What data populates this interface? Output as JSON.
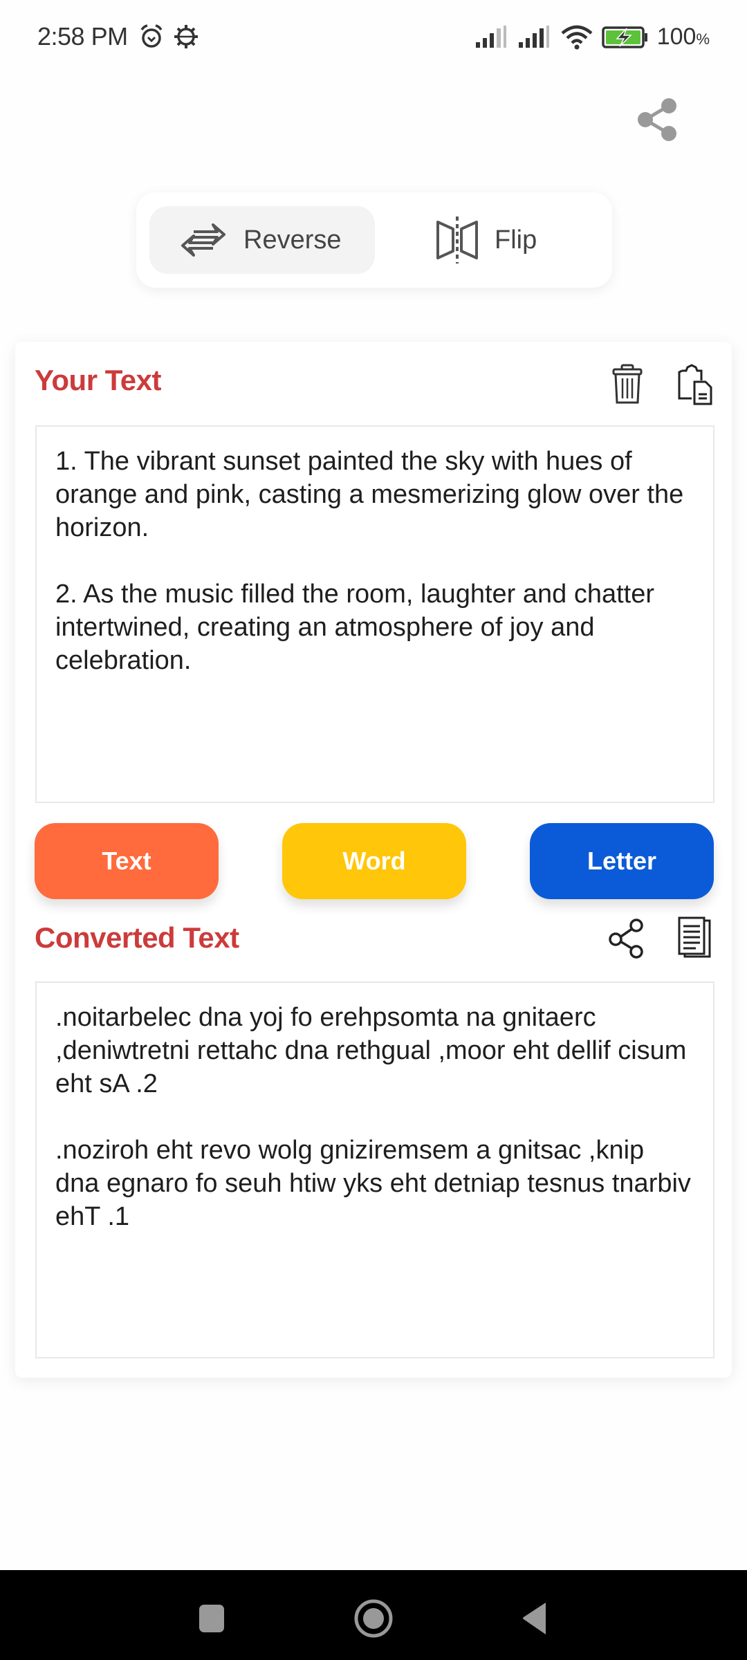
{
  "status_bar": {
    "time": "2:58 PM",
    "left_icons": [
      "alarm-icon",
      "settings-icon"
    ],
    "right_icons": [
      "signal-sim1-icon",
      "signal-sim2-icon",
      "wifi-icon",
      "battery-charging-icon"
    ],
    "battery_percent": "100",
    "battery_unit": "%"
  },
  "header": {
    "share_icon": "share-icon"
  },
  "mode_switch": {
    "options": [
      {
        "label": "Reverse",
        "icon": "swap-arrows-icon",
        "selected": true
      },
      {
        "label": "Flip",
        "icon": "mirror-flip-icon",
        "selected": false
      }
    ]
  },
  "input_section": {
    "title": "Your Text",
    "actions": [
      {
        "icon": "trash-icon",
        "label": "Clear"
      },
      {
        "icon": "paste-icon",
        "label": "Paste"
      }
    ],
    "paragraphs": [
      "1. The vibrant sunset painted the sky with hues of orange and pink, casting a mesmerizing glow over the horizon.",
      "2. As the music filled the room, laughter and chatter intertwined, creating an atmosphere of joy and celebration."
    ]
  },
  "convert_buttons": [
    {
      "label": "Text",
      "color": "#ff6b3d"
    },
    {
      "label": "Word",
      "color": "#ffc60a"
    },
    {
      "label": "Letter",
      "color": "#0b5bd9"
    }
  ],
  "output_section": {
    "title": "Converted Text",
    "actions": [
      {
        "icon": "share-icon",
        "label": "Share"
      },
      {
        "icon": "copy-icon",
        "label": "Copy"
      }
    ],
    "paragraphs": [
      ".noitarbelec dna yoj fo erehpsomta na gnitaerc ,deniwtretni rettahc dna rethgual ,moor eht dellif cisum eht sA .2",
      ".noziroh eht revo wolg gniziremsem a gnitsac ,knip dna egnaro fo seuh htiw yks eht detniap tesnus tnarbiv ehT .1"
    ]
  },
  "colors": {
    "title_red": "#cc3b3b",
    "text_button": "#ff6b3d",
    "word_button": "#ffc60a",
    "letter_button": "#0b5bd9",
    "battery_green": "#5cc23a"
  },
  "nav_bar": {
    "items": [
      "recents-icon",
      "home-icon",
      "back-icon"
    ]
  }
}
